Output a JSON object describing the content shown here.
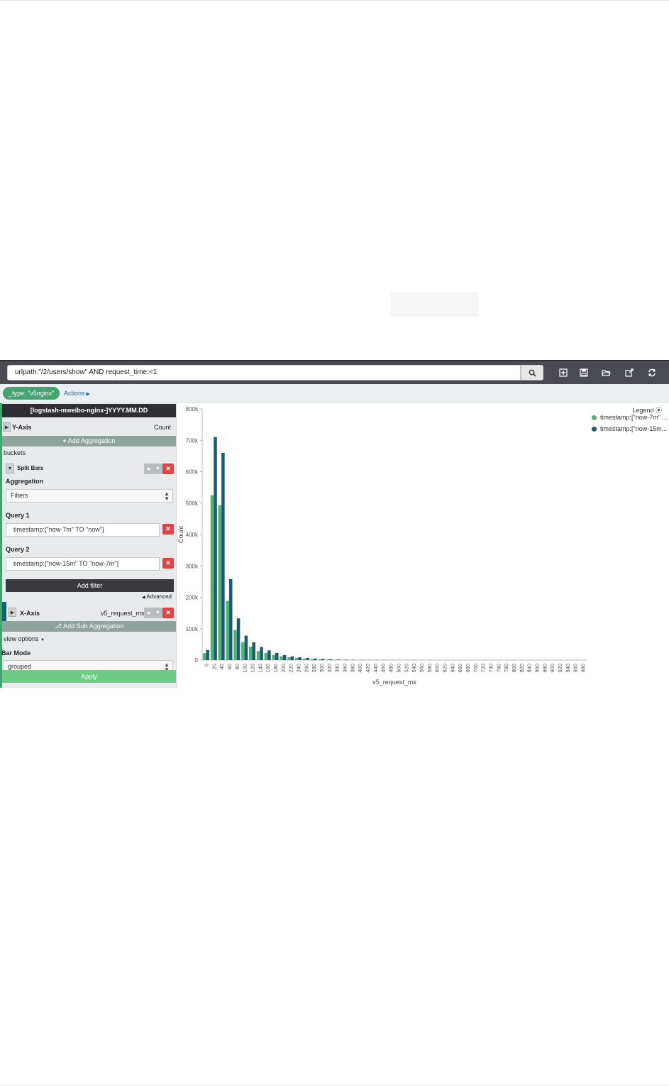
{
  "query": {
    "value": "urlpath:\"/2/users/show\" AND request_time:<1"
  },
  "filterbar": {
    "filter_pill": "_type: \"v5nginx\"",
    "actions": "Actions"
  },
  "sidebar": {
    "index_title": "[logstash-mweibo-nginx-]YYYY.MM.DD",
    "y_axis": {
      "label": "Y-Axis",
      "value": "Count"
    },
    "add_aggregation": "Add Aggregation",
    "buckets": "buckets",
    "split_bars": "Split Bars",
    "aggregation_label": "Aggregation",
    "aggregation_value": "Filters",
    "query1": {
      "label": "Query 1",
      "value": "timestamp:[\"now-7m\" TO \"now\"]"
    },
    "query2": {
      "label": "Query 2",
      "value": "timestamp:[\"now-15m\" TO \"now-7m\"]"
    },
    "add_filter": "Add filter",
    "advanced": "Advanced",
    "x_axis": {
      "label": "X-Axis",
      "value": "v5_request_ms"
    },
    "add_sub_aggregation": "Add Sub Aggregation",
    "view_options": "view options",
    "bar_mode_label": "Bar Mode",
    "bar_mode_value": "grouped",
    "apply": "Apply"
  },
  "legend": {
    "title": "Legend",
    "items": [
      {
        "label": "timestamp:[\"now-7m\" ...",
        "color": "#4fb377"
      },
      {
        "label": "timestamp:[\"now-15m...",
        "color": "#1f5b6e"
      }
    ]
  },
  "colors": {
    "accent": "#45a271",
    "series1": "#4fb377",
    "series2": "#1f5b6e",
    "danger": "#e04545"
  },
  "chart_data": {
    "type": "bar",
    "xlabel": "v5_request_ms",
    "ylabel": "Count",
    "ylim": [
      0,
      800000
    ],
    "yticks": [
      "0",
      "100k",
      "200k",
      "300k",
      "400k",
      "500k",
      "600k",
      "700k",
      "800k"
    ],
    "categories": [
      "0",
      "20",
      "40",
      "60",
      "80",
      "100",
      "120",
      "140",
      "160",
      "180",
      "200",
      "220",
      "240",
      "260",
      "280",
      "300",
      "320",
      "340",
      "360",
      "380",
      "400",
      "420",
      "440",
      "460",
      "480",
      "500",
      "520",
      "540",
      "560",
      "580",
      "600",
      "620",
      "640",
      "660",
      "680",
      "700",
      "720",
      "740",
      "760",
      "780",
      "800",
      "820",
      "840",
      "860",
      "880",
      "900",
      "920",
      "940",
      "960",
      "980"
    ],
    "series": [
      {
        "name": "timestamp:[\"now-7m\" ...",
        "values": [
          22000,
          525000,
          493000,
          189000,
          96000,
          57000,
          43000,
          29000,
          23000,
          17000,
          12000,
          9000,
          7000,
          5000,
          4000,
          3000,
          2000,
          1500,
          1200,
          1000,
          900,
          800,
          700,
          600,
          500,
          500,
          400,
          400,
          300,
          300,
          300,
          300,
          300,
          300,
          300,
          300,
          300,
          300,
          300,
          300,
          300,
          300,
          300,
          300,
          300,
          300,
          300,
          300,
          300,
          300
        ]
      },
      {
        "name": "timestamp:[\"now-15m...",
        "values": [
          32000,
          710000,
          660000,
          258000,
          133000,
          78000,
          57000,
          42000,
          31000,
          23000,
          16000,
          12000,
          9000,
          7000,
          5000,
          4000,
          3000,
          2000,
          1500,
          1200,
          1000,
          900,
          800,
          700,
          600,
          600,
          500,
          500,
          400,
          400,
          400,
          400,
          400,
          400,
          400,
          400,
          500,
          400,
          400,
          400,
          400,
          400,
          400,
          400,
          400,
          400,
          400,
          400,
          400,
          400
        ]
      }
    ],
    "legend": "top-right",
    "grid": false
  }
}
